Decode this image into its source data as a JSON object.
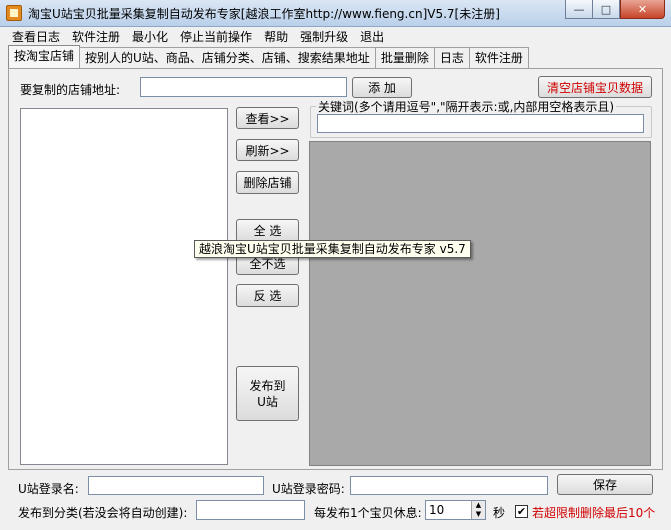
{
  "window": {
    "title": "淘宝U站宝贝批量采集复制自动发布专家[越浪工作室http://www.fieng.cn]V5.7[未注册]",
    "min_label": "—",
    "max_label": "□",
    "close_label": "✕"
  },
  "menu": [
    "查看日志",
    "软件注册",
    "最小化",
    "停止当前操作",
    "帮助",
    "强制升级",
    "退出"
  ],
  "tabs": [
    "按淘宝店铺",
    "按别人的U站、商品、店铺分类、店铺、搜索结果地址",
    "批量删除",
    "日志",
    "软件注册"
  ],
  "shop": {
    "url_label": "要复制的店铺地址:",
    "url_value": "",
    "add_button": "添  加",
    "clear_button": "清空店铺宝贝数据"
  },
  "actions": {
    "view": "查看>>",
    "refresh": "刷新>>",
    "delete_shop": "删除店铺",
    "select_all": "全  选",
    "select_none": "全不选",
    "invert": "反  选",
    "publish": "发布到\nU站"
  },
  "keywords": {
    "label": "关键词(多个请用逗号\",\"隔开表示:或,内部用空格表示且)",
    "value": ""
  },
  "tooltip": "越浪淘宝U站宝贝批量采集复制自动发布专家 v5.7",
  "bottom": {
    "login_label": "U站登录名:",
    "login_value": "",
    "password_label": "U站登录密码:",
    "password_value": "",
    "save_button": "保存",
    "category_label": "发布到分类(若没会将自动创建):",
    "category_value": "",
    "rest_label": "每发布1个宝贝休息:",
    "rest_value": "10",
    "seconds_unit": "秒",
    "overlimit_checked": true,
    "overlimit_label": "若超限制删除最后10个"
  }
}
